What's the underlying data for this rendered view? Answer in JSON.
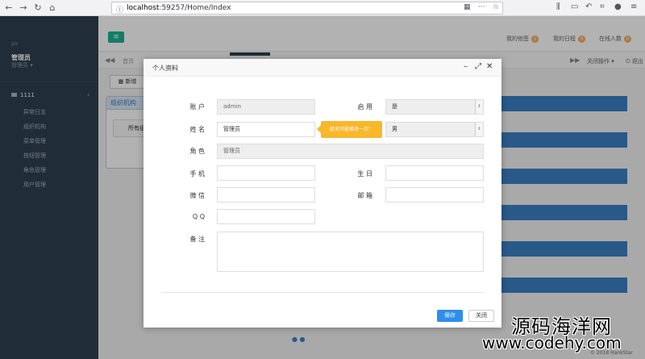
{
  "browser": {
    "url_host": "localhost",
    "url_path": ":59257/Home/Index",
    "more": "···"
  },
  "sidebar": {
    "user_small": "pic",
    "user_name": "管理员",
    "user_role": "管理员 ▾",
    "group_label": "1111",
    "items": [
      "异常日志",
      "组织机构",
      "菜单管理",
      "按钮管理",
      "角色管理",
      "用户管理"
    ]
  },
  "topbar": {
    "links": [
      {
        "label": "我的他签",
        "count": "2"
      },
      {
        "label": "我的日程",
        "count": "0"
      },
      {
        "label": "在线人数",
        "count": "0"
      }
    ]
  },
  "tabbar": {
    "home_tab": "首页",
    "close_ops": "关闭操作 ▾",
    "logout": "退出"
  },
  "content": {
    "add_button": "新增",
    "org_panel_title": "组织机构",
    "org_all": "所有组织"
  },
  "dialog": {
    "title": "个人资料",
    "fields": {
      "account_label": "账 户",
      "account_value": "admin",
      "enabled_label": "启 用",
      "enabled_value": "是",
      "name_label": "姓 名",
      "name_value": "管理员",
      "gender_value": "男",
      "role_label": "角 色",
      "role_value": "管理员",
      "phone_label": "手 机",
      "birthday_label": "生 日",
      "wechat_label": "微 信",
      "email_label": "邮 箱",
      "qq_label": "Q Q",
      "remark_label": "备 注"
    },
    "tooltip": "姓名只能修改一次！",
    "save": "保存",
    "close": "关闭"
  },
  "footer": {
    "copyright": "© 2018 HankStar"
  },
  "watermark": {
    "line1": "源码海洋网",
    "line2": "www.codehy.com"
  }
}
